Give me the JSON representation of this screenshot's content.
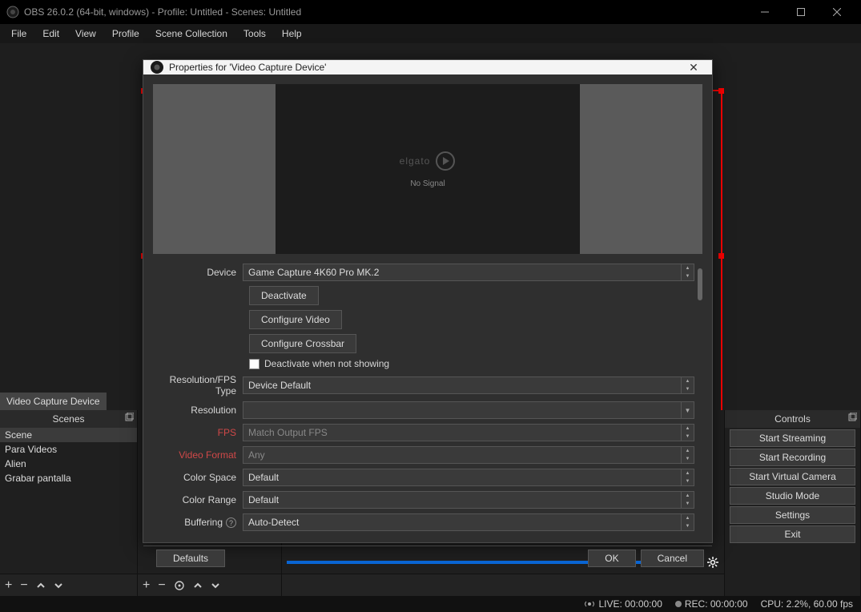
{
  "titlebar": {
    "text": "OBS 26.0.2 (64-bit, windows) - Profile: Untitled - Scenes: Untitled"
  },
  "menu": [
    "File",
    "Edit",
    "View",
    "Profile",
    "Scene Collection",
    "Tools",
    "Help"
  ],
  "source_label": "Video Capture Device",
  "scenes": {
    "title": "Scenes",
    "items": [
      "Scene",
      "Para Videos",
      "Alien",
      "Grabar pantalla"
    ]
  },
  "controls": {
    "title": "Controls",
    "buttons": [
      "Start Streaming",
      "Start Recording",
      "Start Virtual Camera",
      "Studio Mode",
      "Settings",
      "Exit"
    ]
  },
  "status": {
    "live": "LIVE: 00:00:00",
    "rec": "REC: 00:00:00",
    "cpu": "CPU: 2.2%, 60.00 fps"
  },
  "dialog": {
    "title": "Properties for 'Video Capture Device'",
    "preview_brand": "elgato",
    "preview_nosignal": "No Signal",
    "labels": {
      "device": "Device",
      "resfps": "Resolution/FPS Type",
      "resolution": "Resolution",
      "fps": "FPS",
      "vformat": "Video Format",
      "cspace": "Color Space",
      "crange": "Color Range",
      "buffering": "Buffering"
    },
    "values": {
      "device": "Game Capture 4K60 Pro MK.2",
      "resfps": "Device Default",
      "resolution": "",
      "fps": "Match Output FPS",
      "vformat": "Any",
      "cspace": "Default",
      "crange": "Default",
      "buffering": "Auto-Detect"
    },
    "buttons": {
      "deactivate": "Deactivate",
      "conf_video": "Configure Video",
      "conf_crossbar": "Configure Crossbar"
    },
    "checkbox": "Deactivate when not showing",
    "footer": {
      "defaults": "Defaults",
      "ok": "OK",
      "cancel": "Cancel"
    }
  }
}
